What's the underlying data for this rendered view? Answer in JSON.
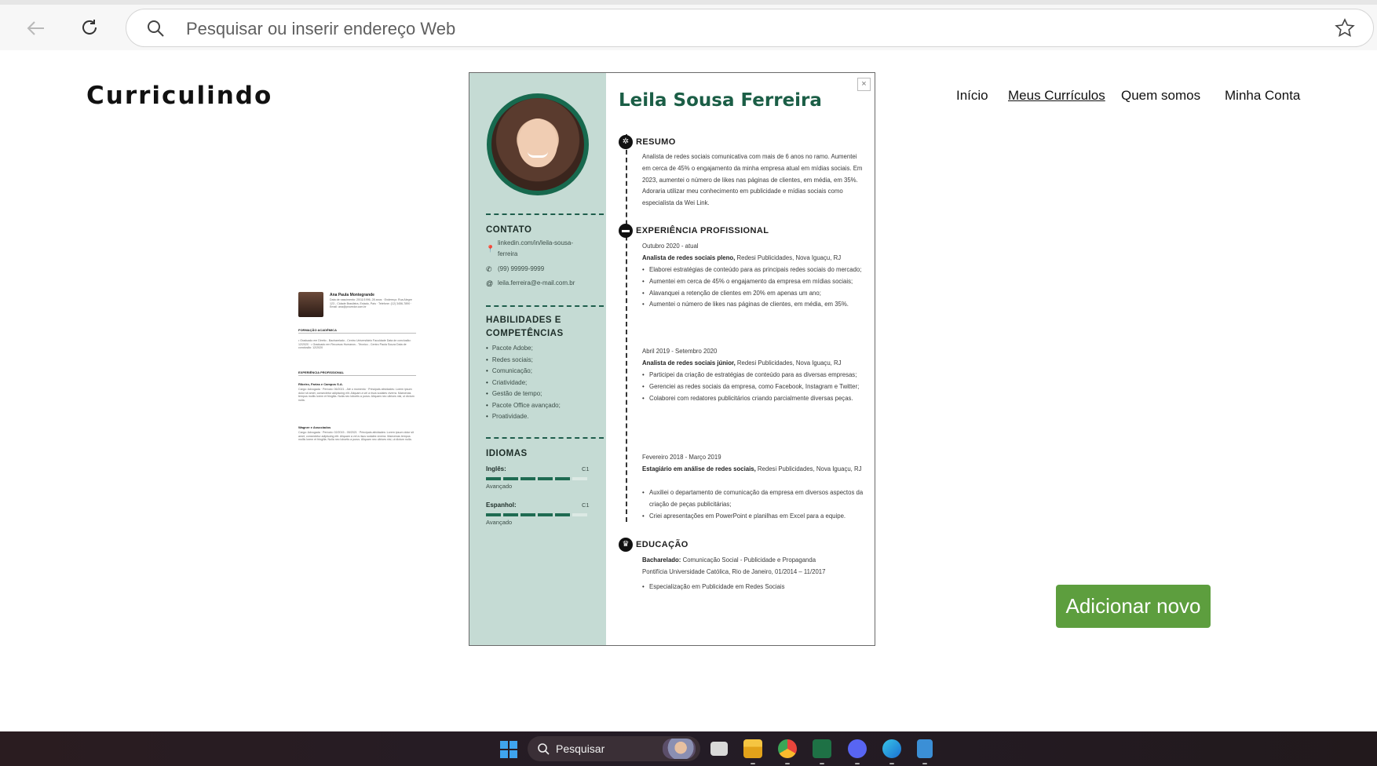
{
  "browser": {
    "address_placeholder": "Pesquisar ou inserir endereço Web"
  },
  "site": {
    "logo": "Curriculindo",
    "nav": [
      "Início",
      "Meus Currículos",
      "Quem somos",
      "Minha Conta"
    ],
    "add_button": "Adicionar novo",
    "accent_color": "#5d9e3e"
  },
  "thumbnail": {
    "name": "Ana Paula Montegrande",
    "info": "Data de nascimento: 20/11/1996, 28 anos · Endereço: Rua Alegre 123 - Cidade Brasileira, Estado, País · Telefone: (12) 3456-7890 · Email: ana@provedor.com.br",
    "sec1": "FORMAÇÃO ACADÊMICA",
    "sec1_items": "• Graduado em Direito - Bacharelado - Centro Universitário Faculdade Data de conclusão: 12/2020 · • Graduado em Recursos Humanos - Técnico - Centro Paula Souza Data de conclusão: 12/2020",
    "sec2": "EXPERIÊNCIA PROFISSIONAL",
    "job1": "Ribeiro, Farias e Campos S.A.",
    "job1_text": "Cargo: Advogada · Período: 06/2021 - Até o momento · Principais atividades: Lorem ipsum dolor sit amet, consectetur adipiscing elit. Aliquam a vel a risus sodales viverra. Maecenas tempus mollis lorem et fringilla. Nulla nec lobortis a purus. Aliquam nec ultrices nisi, ut dictum nulla.",
    "job2": "Wagner e Associados",
    "job2_text": "Cargo: Advogada · Período: 02/2015 - 05/2021 · Principais atividades: Lorem ipsum dolor sit amet, consectetur adipiscing elit. Aliquam a vel a risus sodales viverra. Maecenas tempus mollis lorem et fringilla. Nulla nec lobortis a purus. Aliquam nec ultrices nisi, ut dictum nulla."
  },
  "cv": {
    "name": "Leila Sousa Ferreira",
    "close": "×",
    "contato_h": "CONTATO",
    "linkedin_1": "linkedin.com/in/leila-sousa-",
    "linkedin_2": "ferreira",
    "phone": "(99) 99999-9999",
    "email": "leila.ferreira@e-mail.com.br",
    "skills_h1": "HABILIDADES E",
    "skills_h2": "COMPETÊNCIAS",
    "skills": [
      "Pacote Adobe;",
      "Redes sociais;",
      "Comunicação;",
      "Criatividade;",
      "Gestão de tempo;",
      "Pacote Office avançado;",
      "Proatividade."
    ],
    "idiomas_h": "IDIOMAS",
    "lang1": "Inglês:",
    "lang1_level": "C1",
    "lang1_sub": "Avançado",
    "lang1_bars": 5,
    "lang2": "Espanhol:",
    "lang2_level": "C1",
    "lang2_sub": "Avançado",
    "lang2_bars": 5,
    "resumo_h": "RESUMO",
    "resumo": "Analista de redes sociais comunicativa com mais de 6 anos no ramo. Aumentei em cerca de 45% o engajamento da minha empresa atual em mídias sociais. Em 2023, aumentei o número de likes nas páginas de clientes, em média, em 35%. Adoraria utilizar meu conhecimento em publicidade e mídias sociais como especialista da Wei Link.",
    "exp_h": "EXPERIÊNCIA PROFISSIONAL",
    "exp1_period": "Outubro 2020 - atual",
    "exp1_role": "Analista de redes sociais pleno,",
    "exp1_company": "Redesi Publicidades, Nova Iguaçu, RJ",
    "exp1_items": [
      "Elaborei estratégias de conteúdo para as principais redes sociais do mercado;",
      "Aumentei em cerca de 45% o engajamento da empresa em mídias sociais;",
      "Alavanquei a retenção de clientes em 20% em apenas um ano;",
      "Aumentei o número de likes nas páginas de clientes, em média, em 35%."
    ],
    "exp2_period": "Abril 2019 - Setembro 2020",
    "exp2_role": "Analista de redes sociais júnior,",
    "exp2_company": "Redesi Publicidades, Nova Iguaçu, RJ",
    "exp2_items": [
      "Participei da criação de estratégias de conteúdo para as diversas empresas;",
      "Gerenciei as redes sociais da empresa, como Facebook, Instagram e Twitter;",
      "Colaborei com redatores publicitários criando parcialmente diversas peças."
    ],
    "exp3_period": "Fevereiro 2018 - Março 2019",
    "exp3_role": "Estagiário em análise de redes sociais,",
    "exp3_company": "Redesi Publicidades, Nova Iguaçu, RJ",
    "exp3_items": [
      "Auxiliei o departamento de comunicação da empresa em diversos aspectos da criação de peças publicitárias;",
      "Criei apresentações em PowerPoint e planilhas em Excel para a equipe."
    ],
    "edu_h": "EDUCAÇÃO",
    "edu_degree": "Bacharelado:",
    "edu_course": "Comunicação Social - Publicidade e Propaganda",
    "edu_school": "Pontifícia Universidade Católica, Rio de Janeiro, 01/2014 – 11/2017",
    "edu_items": [
      "Especialização em Publicidade em Redes Sociais"
    ]
  },
  "taskbar": {
    "search_label": "Pesquisar",
    "apps": [
      "task-view-icon",
      "file-explorer-icon",
      "chrome-icon",
      "excel-icon",
      "discord-icon",
      "edge-icon",
      "notepad-icon"
    ]
  }
}
